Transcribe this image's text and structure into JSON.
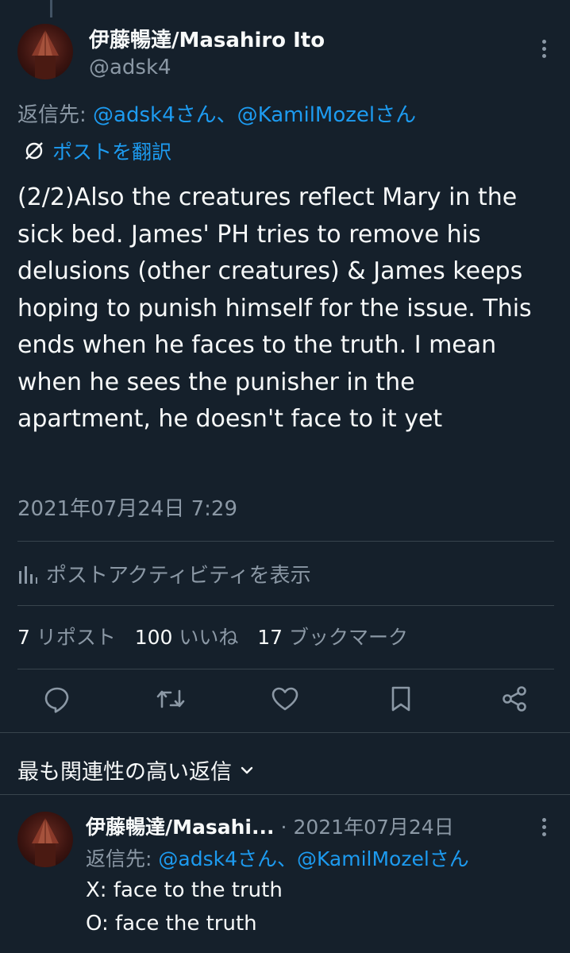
{
  "main_tweet": {
    "author_name": "伊藤暢達/Masahiro Ito",
    "author_handle": "@adsk4",
    "reply_prefix": "返信先: ",
    "reply_to": "@adsk4さん、@KamilMozelさん",
    "translate_label": "ポストを翻訳",
    "text": "(2/2)Also the creatures reflect Mary in the sick bed. James' PH tries to remove his delusions (other creatures) & James keeps hoping to punish himself for the issue. This ends when he faces to the truth. I mean when he sees the punisher in the apartment, he doesn't face to it yet",
    "timestamp": "2021年07月24日 7:29",
    "activity_label": "ポストアクティビティを表示",
    "stats": {
      "reposts_count": "7",
      "reposts_label": "リポスト",
      "likes_count": "100",
      "likes_label": "いいね",
      "bookmarks_count": "17",
      "bookmarks_label": "ブックマーク"
    }
  },
  "actions": [
    "reply-icon",
    "repost-icon",
    "like-icon",
    "bookmark-icon",
    "share-icon"
  ],
  "replies_section": {
    "sort_label": "最も関連性の高い返信"
  },
  "reply": {
    "author_name": "伊藤暢達/Masahi...",
    "date": "2021年07月24日",
    "separator": "·",
    "reply_prefix": "返信先: ",
    "reply_to": "@adsk4さん、@KamilMozelさん",
    "lines": [
      "X: face to the truth",
      "O: face the truth"
    ]
  },
  "colors": {
    "background": "#15202b",
    "text": "#f7f9f9",
    "muted": "#8b98a5",
    "accent": "#1d9bf0",
    "divider": "#38444d"
  }
}
